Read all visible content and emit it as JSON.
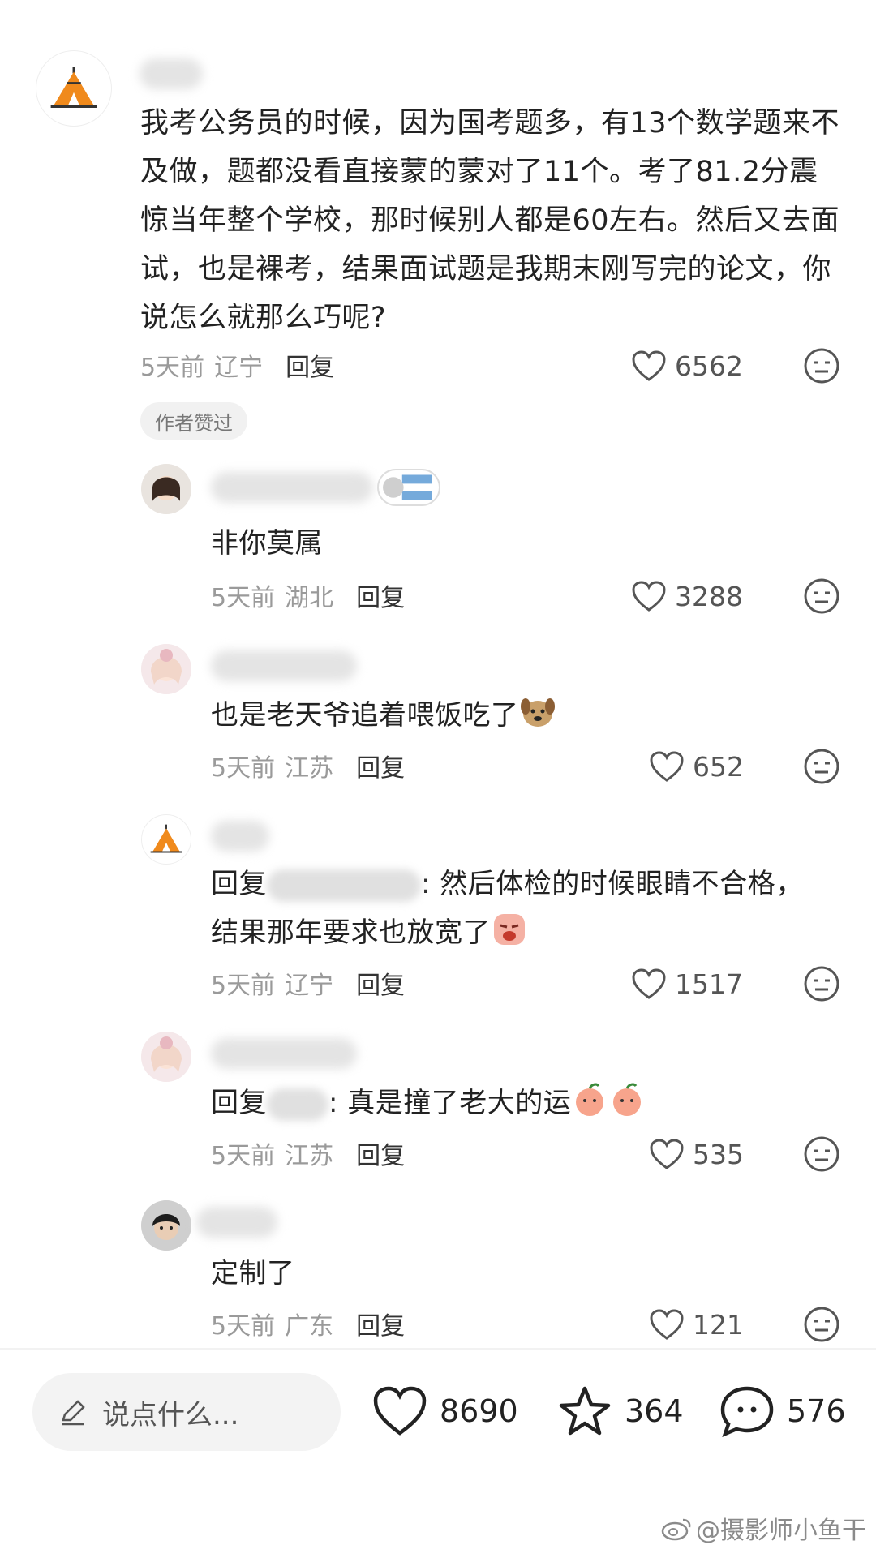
{
  "colors": {
    "text": "#222222",
    "meta": "#9a9a9a",
    "accent": "#f08a1c"
  },
  "main_comment": {
    "avatar": "tent-avatar",
    "text": "我考公务员的时候，因为国考题多，有13个数学题来不及做，题都没看直接蒙的蒙对了11个。考了81.2分震惊当年整个学校，那时候别人都是60左右。然后又去面试，也是裸考，结果面试题是我期末刚写完的论文，你说怎么就那么巧呢?",
    "time": "5天前",
    "location": "辽宁",
    "reply_label": "回复",
    "likes": "6562",
    "badge": "作者赞过"
  },
  "replies": [
    {
      "avatar": "girl-avatar",
      "text": "非你莫属",
      "time": "5天前",
      "location": "湖北",
      "reply_label": "回复",
      "likes": "3288"
    },
    {
      "avatar": "doll-avatar",
      "text": "也是老天爷追着喂饭吃了",
      "time": "5天前",
      "location": "江苏",
      "reply_label": "回复",
      "likes": "652"
    },
    {
      "avatar": "tent-avatar",
      "prefix": "回复",
      "suffix": ": 然后体检的时候眼睛不合格，",
      "text2": "结果那年要求也放宽了",
      "time": "5天前",
      "location": "辽宁",
      "reply_label": "回复",
      "likes": "1517"
    },
    {
      "avatar": "doll-avatar",
      "prefix": "回复",
      "suffix": ": 真是撞了老大的运",
      "time": "5天前",
      "location": "江苏",
      "reply_label": "回复",
      "likes": "535"
    },
    {
      "avatar": "boy-avatar",
      "text": "定制了",
      "time": "5天前",
      "location": "广东",
      "reply_label": "回复",
      "likes": "121"
    }
  ],
  "bottom_bar": {
    "input_placeholder": "说点什么...",
    "likes": "8690",
    "favorites": "364",
    "comments": "576"
  },
  "watermark": "@摄影师小鱼干"
}
